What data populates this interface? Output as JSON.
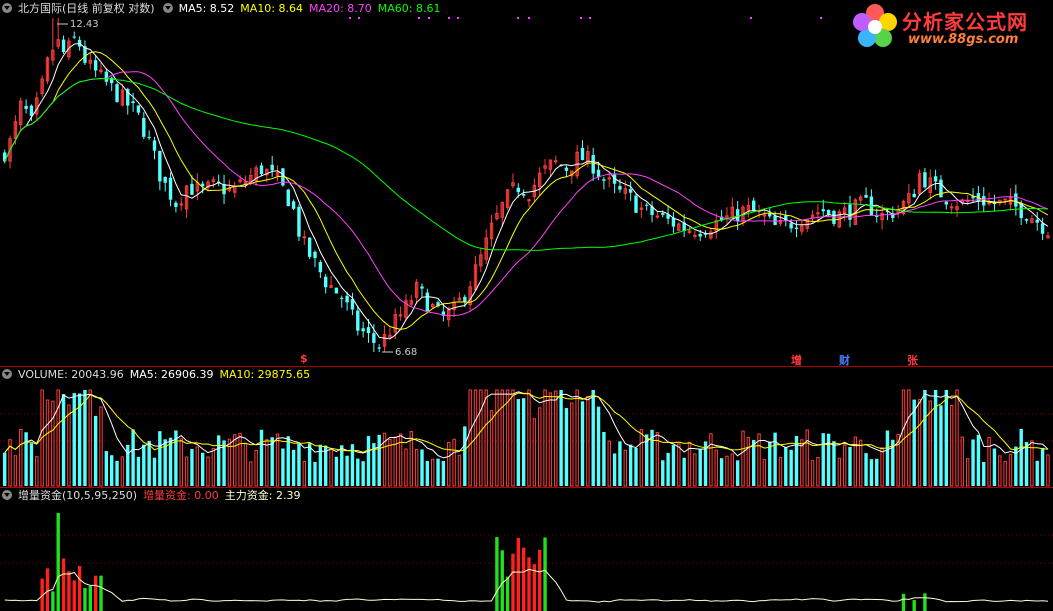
{
  "colors": {
    "up": "#ff3c3c",
    "down": "#54ffff",
    "ma5": "#ffffff",
    "ma10": "#ffff00",
    "ma20": "#ff40ff",
    "ma60": "#00ff00",
    "grid": "#8b0000",
    "zlzj": "#ffffcc"
  },
  "main": {
    "title": "北方国际(日线 前复权 对数)",
    "ma5": "MA5: 8.52",
    "ma10": "MA10: 8.64",
    "ma20": "MA20: 8.70",
    "ma60": "MA60: 8.61",
    "high_label": "12.43",
    "low_label": "6.68",
    "markers": [
      "$",
      "增",
      "财",
      "张"
    ]
  },
  "volume_panel": {
    "title": "VOLUME: 20043.96",
    "ma5": "MA5: 26906.39",
    "ma10": "MA10: 29875.65"
  },
  "fund_panel": {
    "title": "增量资金(10,5,95,250)",
    "zlzj": "增量资金: 0.00",
    "zhulizj": "主力资金: 2.39"
  },
  "logo": {
    "title": "分析家公式网",
    "url": "www.88gs.com"
  },
  "chart_data": {
    "type": "candlestick",
    "price_scale": "log",
    "price_high": 12.43,
    "price_low": 6.68,
    "close_anchors": [
      [
        0,
        9.6
      ],
      [
        10,
        9.9
      ],
      [
        20,
        10.6
      ],
      [
        30,
        10.2
      ],
      [
        40,
        10.9
      ],
      [
        48,
        11.6
      ],
      [
        55,
        11.9
      ],
      [
        63,
        11.6
      ],
      [
        75,
        12.0
      ],
      [
        85,
        11.4
      ],
      [
        95,
        11.2
      ],
      [
        105,
        11.0
      ],
      [
        115,
        10.8
      ],
      [
        125,
        10.6
      ],
      [
        135,
        10.4
      ],
      [
        145,
        10.0
      ],
      [
        160,
        9.2
      ],
      [
        175,
        8.8
      ],
      [
        185,
        9.1
      ],
      [
        200,
        9.0
      ],
      [
        215,
        9.1
      ],
      [
        230,
        9.0
      ],
      [
        245,
        9.2
      ],
      [
        260,
        9.4
      ],
      [
        275,
        9.2
      ],
      [
        290,
        8.8
      ],
      [
        300,
        8.2
      ],
      [
        312,
        7.9
      ],
      [
        325,
        7.6
      ],
      [
        340,
        7.4
      ],
      [
        355,
        7.0
      ],
      [
        368,
        6.85
      ],
      [
        378,
        6.75
      ],
      [
        390,
        7.0
      ],
      [
        402,
        7.2
      ],
      [
        415,
        7.5
      ],
      [
        428,
        7.3
      ],
      [
        440,
        7.1
      ],
      [
        452,
        7.2
      ],
      [
        465,
        7.5
      ],
      [
        478,
        7.9
      ],
      [
        490,
        8.4
      ],
      [
        502,
        8.8
      ],
      [
        515,
        9.1
      ],
      [
        528,
        9.0
      ],
      [
        540,
        9.3
      ],
      [
        552,
        9.5
      ],
      [
        565,
        9.4
      ],
      [
        578,
        9.6
      ],
      [
        590,
        9.5
      ],
      [
        602,
        9.2
      ],
      [
        615,
        9.0
      ],
      [
        628,
        8.9
      ],
      [
        640,
        8.7
      ],
      [
        655,
        8.6
      ],
      [
        670,
        8.5
      ],
      [
        685,
        8.4
      ],
      [
        700,
        8.4
      ],
      [
        715,
        8.5
      ],
      [
        730,
        8.6
      ],
      [
        745,
        8.7
      ],
      [
        760,
        8.6
      ],
      [
        775,
        8.4
      ],
      [
        790,
        8.5
      ],
      [
        805,
        8.6
      ],
      [
        820,
        8.7
      ],
      [
        835,
        8.6
      ],
      [
        850,
        8.7
      ],
      [
        865,
        8.8
      ],
      [
        880,
        8.6
      ],
      [
        895,
        8.7
      ],
      [
        910,
        8.9
      ],
      [
        918,
        9.3
      ],
      [
        930,
        9.1
      ],
      [
        945,
        8.9
      ],
      [
        960,
        8.8
      ],
      [
        975,
        8.9
      ],
      [
        990,
        8.8
      ],
      [
        1005,
        8.8
      ],
      [
        1020,
        8.7
      ],
      [
        1030,
        8.6
      ],
      [
        1045,
        8.4
      ]
    ],
    "volume_ma5": 26906.39,
    "volume_ma10": 29875.65,
    "volume_last": 20043.96
  }
}
